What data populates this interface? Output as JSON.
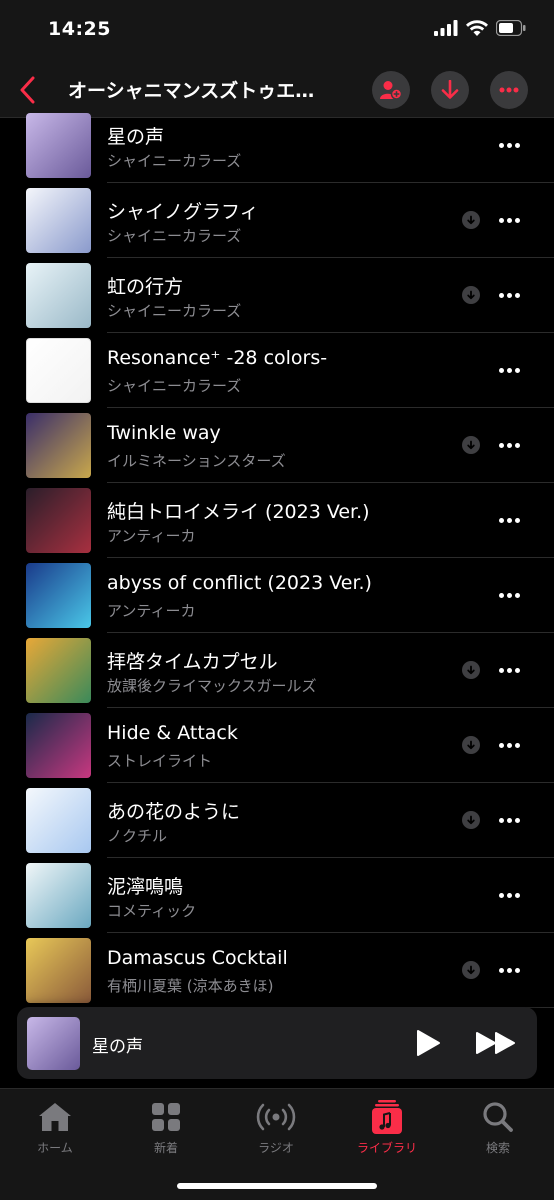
{
  "status": {
    "time": "14:25"
  },
  "header": {
    "title": "オーシャニマンスズトゥエ…"
  },
  "songs": [
    {
      "title": "星の声",
      "artist": "シャイニーカラーズ",
      "downloadable": false
    },
    {
      "title": "シャイノグラフィ",
      "artist": "シャイニーカラーズ",
      "downloadable": true
    },
    {
      "title": "虹の行方",
      "artist": "シャイニーカラーズ",
      "downloadable": true
    },
    {
      "title": "Resonance⁺ -28 colors-",
      "artist": "シャイニーカラーズ",
      "downloadable": false
    },
    {
      "title": "Twinkle way",
      "artist": "イルミネーションスターズ",
      "downloadable": true
    },
    {
      "title": "純白トロイメライ (2023 Ver.)",
      "artist": "アンティーカ",
      "downloadable": false
    },
    {
      "title": "abyss of conflict (2023 Ver.)",
      "artist": "アンティーカ",
      "downloadable": false
    },
    {
      "title": "拝啓タイムカプセル",
      "artist": "放課後クライマックスガールズ",
      "downloadable": true
    },
    {
      "title": "Hide & Attack",
      "artist": "ストレイライト",
      "downloadable": true
    },
    {
      "title": "あの花のように",
      "artist": "ノクチル",
      "downloadable": true
    },
    {
      "title": "泥濘鳴鳴",
      "artist": "コメティック",
      "downloadable": false
    },
    {
      "title": "Damascus Cocktail",
      "artist": "有栖川夏葉 (涼本あきほ)",
      "downloadable": true
    }
  ],
  "artwork_colors": [
    [
      "#c8b8e8",
      "#6a5a9a"
    ],
    [
      "#f4f6fb",
      "#8a9acc"
    ],
    [
      "#e8f3f7",
      "#9ab9c8"
    ],
    [
      "#ffffff",
      "#f2f2f2"
    ],
    [
      "#3a2e6a",
      "#c9a84c"
    ],
    [
      "#2a1e2a",
      "#a83040"
    ],
    [
      "#1a3a8a",
      "#4ac8e8"
    ],
    [
      "#e8a838",
      "#3a8a5a"
    ],
    [
      "#1a2a4a",
      "#c83880"
    ],
    [
      "#f4f8fc",
      "#a8c8f0"
    ],
    [
      "#f0f6f8",
      "#6aa8c0"
    ],
    [
      "#e8c858",
      "#8a5a3a"
    ]
  ],
  "mini_player": {
    "title": "星の声"
  },
  "tabs": [
    {
      "label": "ホーム",
      "icon": "home-icon",
      "active": false
    },
    {
      "label": "新着",
      "icon": "grid-icon",
      "active": false
    },
    {
      "label": "ラジオ",
      "icon": "radio-icon",
      "active": false
    },
    {
      "label": "ライブラリ",
      "icon": "library-icon",
      "active": true
    },
    {
      "label": "検索",
      "icon": "search-icon",
      "active": false
    }
  ],
  "colors": {
    "accent": "#fa2d48",
    "background": "#000000",
    "secondary_text": "#8d8d92"
  }
}
